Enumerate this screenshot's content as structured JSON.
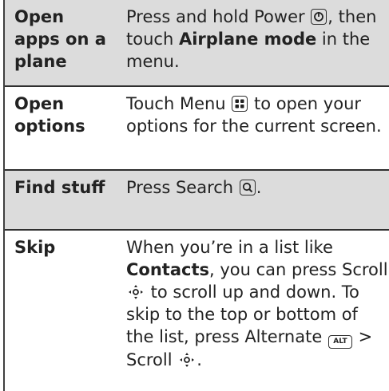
{
  "rows": [
    {
      "term": "Open apps on a plane",
      "desc": {
        "p1": "Press and hold Power ",
        "icon1": "power-key-icon",
        "p2": ", then touch ",
        "bold": "Airplane mode",
        "p3": " in the menu."
      }
    },
    {
      "term": "Open options",
      "desc": {
        "p1": "Touch Menu ",
        "icon1": "menu-key-icon",
        "p2": " to open your options for the current screen."
      }
    },
    {
      "term": "Find stuff",
      "desc": {
        "p1": "Press Search ",
        "icon1": "search-key-icon",
        "p2": "."
      }
    },
    {
      "term": "Skip",
      "desc": {
        "p1": "When you’re in a list like ",
        "bold": "Contacts",
        "p2": ", you can press Scroll ",
        "icon1": "scroll-navigation-icon",
        "p3": " to scroll up and down. To skip to the top or bottom of the list, press Alternate ",
        "alt_key_label": "ALT",
        "p4": " > Scroll ",
        "icon2": "scroll-navigation-icon",
        "p5": "."
      }
    }
  ],
  "colors": {
    "shaded_row": "#dcdcdc",
    "text": "#222222",
    "rule": "#2f2f2f"
  }
}
